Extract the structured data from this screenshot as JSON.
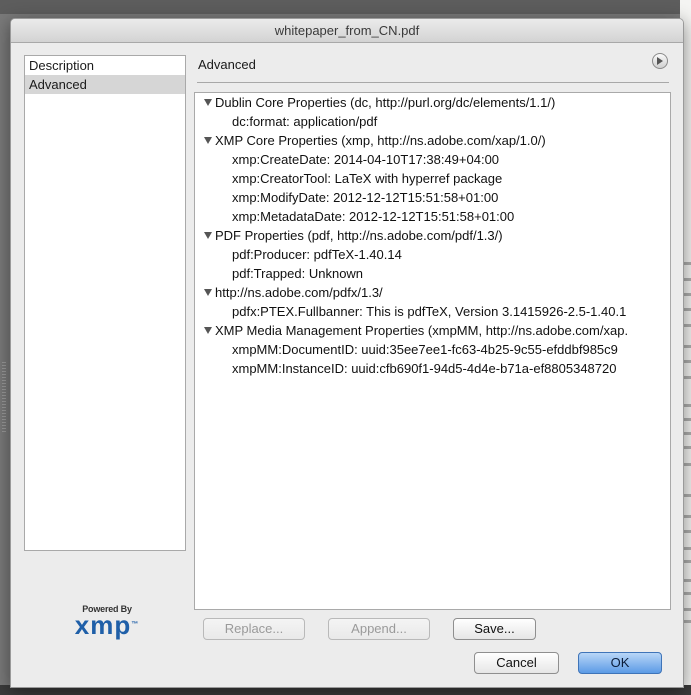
{
  "window": {
    "title": "whitepaper_from_CN.pdf"
  },
  "sidebar": {
    "items": [
      {
        "label": "Description",
        "selected": false
      },
      {
        "label": "Advanced",
        "selected": true
      }
    ]
  },
  "logo": {
    "powered_by": "Powered By",
    "wordmark": "xmp",
    "tm": "™"
  },
  "panel": {
    "title": "Advanced",
    "menu_icon": "panel-menu-icon"
  },
  "tree": {
    "rows": [
      {
        "type": "group",
        "text": "Dublin Core Properties (dc, http://purl.org/dc/elements/1.1/)"
      },
      {
        "type": "prop",
        "text": "dc:format: application/pdf"
      },
      {
        "type": "group",
        "text": "XMP Core Properties (xmp, http://ns.adobe.com/xap/1.0/)"
      },
      {
        "type": "prop",
        "text": "xmp:CreateDate: 2014-04-10T17:38:49+04:00"
      },
      {
        "type": "prop",
        "text": "xmp:CreatorTool: LaTeX with hyperref package"
      },
      {
        "type": "prop",
        "text": "xmp:ModifyDate: 2012-12-12T15:51:58+01:00"
      },
      {
        "type": "prop",
        "text": "xmp:MetadataDate: 2012-12-12T15:51:58+01:00"
      },
      {
        "type": "group",
        "text": "PDF Properties (pdf, http://ns.adobe.com/pdf/1.3/)"
      },
      {
        "type": "prop",
        "text": "pdf:Producer: pdfTeX-1.40.14"
      },
      {
        "type": "prop",
        "text": "pdf:Trapped: Unknown"
      },
      {
        "type": "group",
        "text": "http://ns.adobe.com/pdfx/1.3/"
      },
      {
        "type": "prop",
        "text": "pdfx:PTEX.Fullbanner: This is pdfTeX, Version 3.1415926-2.5-1.40.1"
      },
      {
        "type": "group",
        "text": "XMP Media Management Properties (xmpMM, http://ns.adobe.com/xap."
      },
      {
        "type": "prop",
        "text": "xmpMM:DocumentID: uuid:35ee7ee1-fc63-4b25-9c55-efddbf985c9"
      },
      {
        "type": "prop",
        "text": "xmpMM:InstanceID: uuid:cfb690f1-94d5-4d4e-b71a-ef8805348720"
      }
    ]
  },
  "buttons": {
    "replace": {
      "label": "Replace...",
      "enabled": false
    },
    "append": {
      "label": "Append...",
      "enabled": false
    },
    "save": {
      "label": "Save...",
      "enabled": true
    },
    "cancel": {
      "label": "Cancel"
    },
    "ok": {
      "label": "OK"
    }
  },
  "colors": {
    "ok_button": "#5c9be6",
    "xmp_blue": "#1f5fa8",
    "selection": "#d6d6d6"
  }
}
